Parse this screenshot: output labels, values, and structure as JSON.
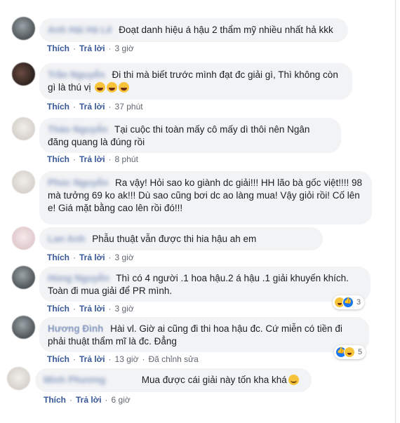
{
  "comments": [
    {
      "name": "Anh Hải Hà Lê",
      "text": "Đoạt danh hiệu á hậu 2 thẩm mỹ nhiều nhất hả kkk",
      "like": "Thích",
      "reply": "Trả lời",
      "time": "3 giờ"
    },
    {
      "name": "Trần Nguyễn",
      "text": "Đi thi mà biết trước mình đạt đc giải gì, Thì không còn gì là thú vị",
      "like": "Thích",
      "reply": "Trả lời",
      "time": "37 phút"
    },
    {
      "name": "Thảo Nguyễn",
      "text": "Tại cuộc thi toàn mấy cô mấy dì thôi nên Ngân đăng quang là đúng rồi",
      "like": "Thích",
      "reply": "Trả lời",
      "time": "8 phút"
    },
    {
      "name": "Phúc Nguyễn",
      "text": "Ra vậy! Hỏi sao ko giành dc giải!!! HH lão bà gốc việt!!!! 98 mà tưởng 69 ko ak!!! Dù sao cũng bơi dc ao làng mua! Vậy giỏi rồi! Cố lên e! Giá mặt bằng cao lên rồi đó!!!",
      "like": "Thích",
      "reply": "Trả lời",
      "time": ""
    },
    {
      "name": "Lan Anh",
      "text": "Phẫu thuật vẫn được thi hia hậu ah em",
      "like": "Thích",
      "reply": "Trả lời",
      "time": "3 giờ"
    },
    {
      "name": "Hùng Nguyễn",
      "text": "Thì có 4 người .1 hoa hậu.2 á hậu .1 giải khuyến khích. Toàn đi mua giải để PR mình.",
      "like": "Thích",
      "reply": "Trả lời",
      "time": "3 giờ",
      "reaction_count": "3"
    },
    {
      "name": "Hương Đình",
      "text": "Hài vl. Giờ ai cũng đi thi hoa hậu đc. Cứ miễn có tiền đi phải thuật thẩm mĩ là đc. Đẳng",
      "like": "Thích",
      "reply": "Trả lời",
      "time": "13 giờ",
      "edited": "Đã chỉnh sửa",
      "reaction_count": "5"
    },
    {
      "name": "Minh Phương",
      "text": "Mua được cái giải này tốn kha khá",
      "like": "Thích",
      "reply": "Trả lời",
      "time": "6 giờ"
    }
  ],
  "icons": {
    "haha": "haha-emoji",
    "like": "like-icon",
    "smile": "smile-emoji"
  }
}
